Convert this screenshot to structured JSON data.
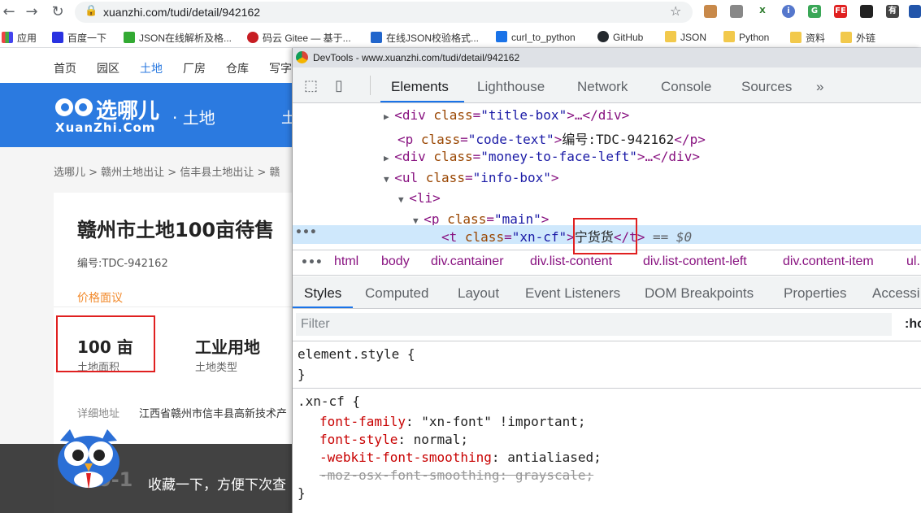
{
  "browser": {
    "url": "xuanzhi.com/tudi/detail/942162",
    "bookmarks": [
      "应用",
      "百度一下",
      "JSON在线解析及格...",
      "码云 Gitee — 基于...",
      "在线JSON校验格式...",
      "curl_to_python",
      "GitHub",
      "JSON",
      "Python",
      "资料",
      "外链"
    ]
  },
  "site": {
    "nav": [
      "首页",
      "园区",
      "土地",
      "厂房",
      "仓库",
      "写字"
    ],
    "logo_cn": "选哪儿",
    "logo_en": "XuanZhi.Com",
    "logo_section": "· 土地",
    "banner_extra": "土",
    "breadcrumb": "选哪儿 > 赣州土地出让 > 信丰县土地出让 > 赣",
    "title": "赣州市土地100亩待售",
    "code": "编号:TDC-942162",
    "price": "价格面议",
    "area_value": "100 亩",
    "area_label": "土地面积",
    "type_value": "工业用地",
    "type_label": "土地类型",
    "address_label": "详细地址",
    "address_value": "江西省赣州市信丰县高新技术产",
    "bottom_number": "0-1",
    "footer_text": "收藏一下，方便下次查"
  },
  "devtools": {
    "title": "DevTools - www.xuanzhi.com/tudi/detail/942162",
    "tabs": [
      "Elements",
      "Lighthouse",
      "Network",
      "Console",
      "Sources",
      "»"
    ],
    "dom": {
      "l1_open": "<div ",
      "l1_attr": "class",
      "l1_val": "\"title-box\"",
      "l1_close": ">…</div>",
      "l2_open": "<p ",
      "l2_attr": "class",
      "l2_val": "\"code-text\"",
      "l2_text": "编号:TDC-942162",
      "l2_close": "</p>",
      "l3_open": "<div ",
      "l3_attr": "class",
      "l3_val": "\"money-to-face-left\"",
      "l3_close": ">…</div>",
      "l4_open": "<ul ",
      "l4_attr": "class",
      "l4_val": "\"info-box\"",
      "l4_close": ">",
      "l5": "<li>",
      "l6_open": "<p ",
      "l6_attr": "class",
      "l6_val": "\"main\"",
      "l6_close": ">",
      "l7_open": "<t ",
      "l7_attr": "class",
      "l7_val": "\"xn-cf\"",
      "l7_text": "宁货货",
      "l7_close": "</t>",
      "l7_eq": " == $0"
    },
    "breadcrumbs": [
      "html",
      "body",
      "div.cantainer",
      "div.list-content",
      "div.list-content-left",
      "div.content-item",
      "ul."
    ],
    "styles_tabs": [
      "Styles",
      "Computed",
      "Layout",
      "Event Listeners",
      "DOM Breakpoints",
      "Properties",
      "Accessi"
    ],
    "filter_placeholder": "Filter",
    "filter_hov": ":ho",
    "rules": {
      "element_style": "element.style {",
      "close": "}",
      "selector": ".xn-cf {",
      "p1": "font-family",
      "v1": "\"xn-font\" !important;",
      "p2": "font-style",
      "v2": "normal;",
      "p3": "-webkit-font-smoothing",
      "v3": "antialiased;",
      "p4": "-moz-osx-font-smoothing: grayscale;"
    }
  }
}
